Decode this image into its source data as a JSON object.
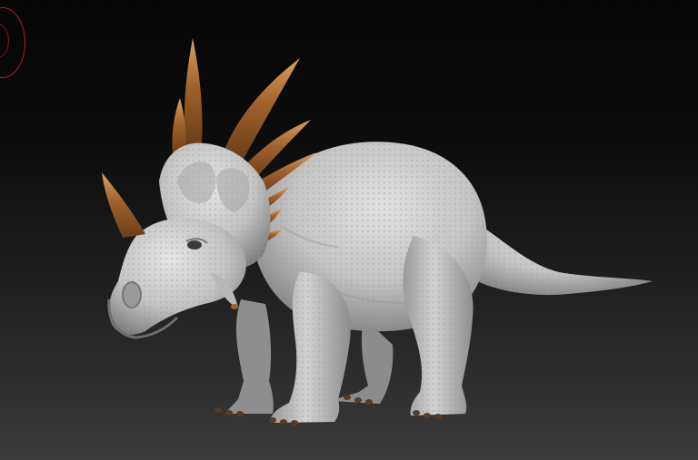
{
  "viewport": {
    "background_top": "#050505",
    "background_bottom": "#3a3a3a"
  },
  "model": {
    "subject": "styracosaurus-sculpt",
    "skin_color": "#c9c9c9",
    "skin_shadow": "#8a8a8a",
    "horn_color": "#a0622c",
    "horn_tip_color": "#d79b5a",
    "claw_color": "#5a3a24"
  },
  "gizmo": {
    "color": "#b3221f"
  }
}
